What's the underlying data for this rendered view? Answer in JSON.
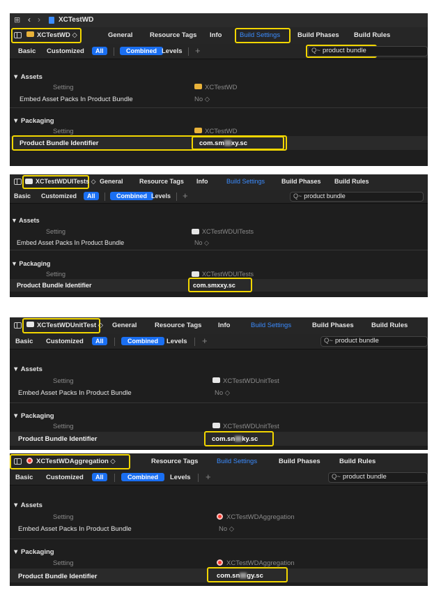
{
  "window": {
    "project_title": "XCTestWD"
  },
  "common": {
    "tabs": [
      "General",
      "Resource Tags",
      "Info",
      "Build Settings",
      "Build Phases",
      "Build Rules"
    ],
    "filters": {
      "basic": "Basic",
      "customized": "Customized",
      "all": "All",
      "combined": "Combined",
      "levels": "Levels",
      "plus": "+"
    },
    "search_value": "product bundle",
    "search_glyph": "Q~",
    "assets": "▼ Assets",
    "packaging": "▼ Packaging",
    "setting": "Setting",
    "embed_label": "Embed Asset Packs In Product Bundle",
    "embed_value": "No ◇",
    "pbi_label": "Product Bundle Identifier"
  },
  "panels": [
    {
      "target": "XCTestWD ◇",
      "column": "XCTestWD",
      "value_a": "com.sm",
      "value_b": "xy.sc"
    },
    {
      "target": "XCTestWDUITests ◇",
      "column": "XCTestWDUITests",
      "value": "com.smxxy.sc"
    },
    {
      "target": "XCTestWDUnitTest ◇",
      "column": "XCTestWDUnitTest",
      "value_a": "com.sn",
      "value_b": "ky.sc"
    },
    {
      "target": "XCTestWDAggregation ◇",
      "column": "XCTestWDAggregation",
      "value_a": "com.sn",
      "value_b": "gy.sc"
    }
  ],
  "colors": {
    "accent": "#1a6ff2",
    "highlight": "#f2d600",
    "background": "#1e1e1e"
  }
}
